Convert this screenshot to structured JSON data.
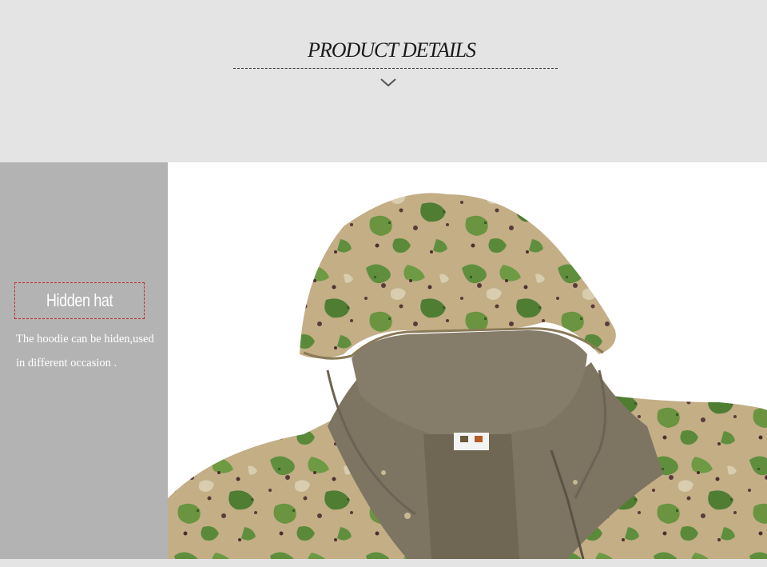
{
  "header": {
    "title": "PRODUCT DETAILS"
  },
  "feature": {
    "heading": "Hidden hat",
    "description": "The hoodie can be  hiden,used in different occasion ."
  },
  "icons": {
    "chevron": "chevron-down-icon"
  },
  "colors": {
    "page_background": "#e4e4e4",
    "sidebar_background": "#b3b3b3",
    "accent_dashed_border": "#c0282d",
    "camo_base": "#c3ae86",
    "camo_green": "#5f8f3d",
    "fleece_lining": "#7d7462"
  }
}
